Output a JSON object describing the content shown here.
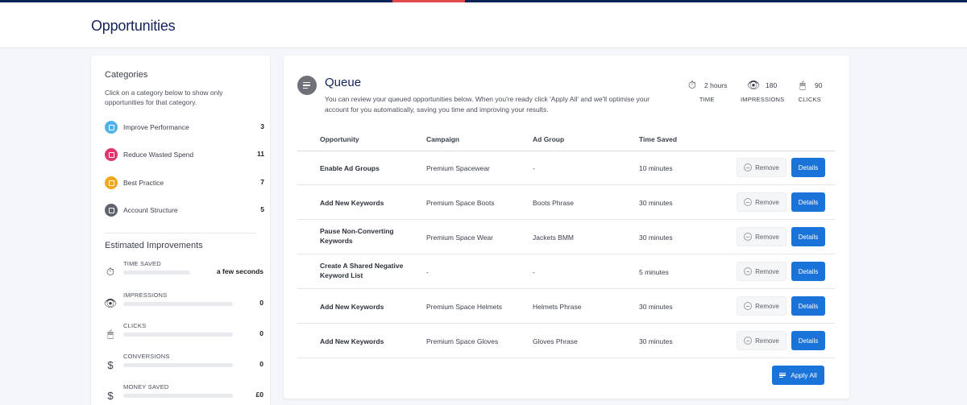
{
  "page": {
    "title": "Opportunities"
  },
  "sidebar": {
    "categories_heading": "Categories",
    "categories_desc": "Click on a category below to show only opportunities for that category.",
    "categories": [
      {
        "label": "Improve Performance",
        "count": "3",
        "color": "#4fb3e8",
        "icon": "chart-icon"
      },
      {
        "label": "Reduce Wasted Spend",
        "count": "11",
        "color": "#e0356f",
        "icon": "wallet-icon"
      },
      {
        "label": "Best Practice",
        "count": "7",
        "color": "#f2a81d",
        "icon": "star-icon"
      },
      {
        "label": "Account Structure",
        "count": "5",
        "color": "#5f636b",
        "icon": "checklist-icon"
      }
    ],
    "estimates_heading": "Estimated Improvements",
    "estimates": [
      {
        "label": "TIME SAVED",
        "value": "a few seconds",
        "icon": "stopwatch-icon"
      },
      {
        "label": "IMPRESSIONS",
        "value": "0",
        "icon": "eye-icon"
      },
      {
        "label": "CLICKS",
        "value": "0",
        "icon": "mouse-icon"
      },
      {
        "label": "CONVERSIONS",
        "value": "0",
        "icon": "dollar-icon"
      },
      {
        "label": "MONEY SAVED",
        "value": "£0",
        "icon": "dollar-slash-icon"
      }
    ]
  },
  "queue": {
    "title": "Queue",
    "description": "You can review your queued opportunities below. When you're ready click 'Apply All' and we'll optimise your account for you automatically, saving you time and improving your results.",
    "stats": [
      {
        "value": "2 hours",
        "label": "TIME",
        "icon": "stopwatch-icon"
      },
      {
        "value": "180",
        "label": "IMPRESSIONS",
        "icon": "eye-icon"
      },
      {
        "value": "90",
        "label": "CLICKS",
        "icon": "mouse-icon"
      }
    ],
    "columns": [
      "Opportunity",
      "Campaign",
      "Ad Group",
      "Time Saved"
    ],
    "rows": [
      {
        "opportunity": "Enable Ad Groups",
        "campaign": "Premium Spacewear",
        "ad_group": "-",
        "time_saved": "10 minutes"
      },
      {
        "opportunity": "Add New Keywords",
        "campaign": "Premium Space Boots",
        "ad_group": "Boots Phrase",
        "time_saved": "30 minutes"
      },
      {
        "opportunity": "Pause Non-Converting Keywords",
        "campaign": "Premium Space Wear",
        "ad_group": "Jackets BMM",
        "time_saved": "30 minutes"
      },
      {
        "opportunity": "Create A Shared Negative Keyword List",
        "campaign": "-",
        "ad_group": "-",
        "time_saved": "5 minutes"
      },
      {
        "opportunity": "Add New Keywords",
        "campaign": "Premium Space Helmets",
        "ad_group": "Helmets Phrase",
        "time_saved": "30 minutes"
      },
      {
        "opportunity": "Add New Keywords",
        "campaign": "Premium Space Gloves",
        "ad_group": "Gloves Phrase",
        "time_saved": "30 minutes"
      }
    ],
    "remove_label": "Remove",
    "details_label": "Details",
    "apply_all_label": "Apply All"
  },
  "colors": {
    "primary": "#1a73d9",
    "title": "#13215a",
    "topbar": "#0d2257",
    "topbar_accent": "#e04a4a"
  }
}
